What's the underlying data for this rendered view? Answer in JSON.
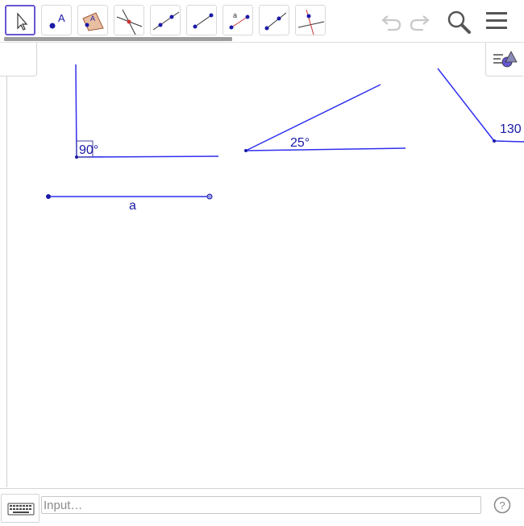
{
  "toolbar": {
    "tools": [
      {
        "id": "move",
        "icon": "cursor-arrow-icon"
      },
      {
        "id": "point",
        "icon": "point-icon",
        "glyph": "A"
      },
      {
        "id": "polygon",
        "icon": "polygon-icon",
        "glyph": "A"
      },
      {
        "id": "intersect",
        "icon": "intersect-icon"
      },
      {
        "id": "line",
        "icon": "line-icon"
      },
      {
        "id": "segment",
        "icon": "segment-icon"
      },
      {
        "id": "segment-length",
        "icon": "segment-fixed-length-icon",
        "glyph": "a"
      },
      {
        "id": "ray",
        "icon": "ray-icon"
      },
      {
        "id": "perpendicular",
        "icon": "perpendicular-line-icon"
      }
    ],
    "active_tool": "move"
  },
  "canvas": {
    "angle_labels": {
      "right_angle": "90°",
      "acute_angle": "25°",
      "obtuse_angle": "130"
    },
    "segment_label": "a"
  },
  "input_bar": {
    "placeholder": "Input…"
  },
  "colors": {
    "accent": "#6557d2",
    "geometry": "#2f2ff0",
    "point": "#1a1aa8",
    "label": "#1a1aa8"
  }
}
